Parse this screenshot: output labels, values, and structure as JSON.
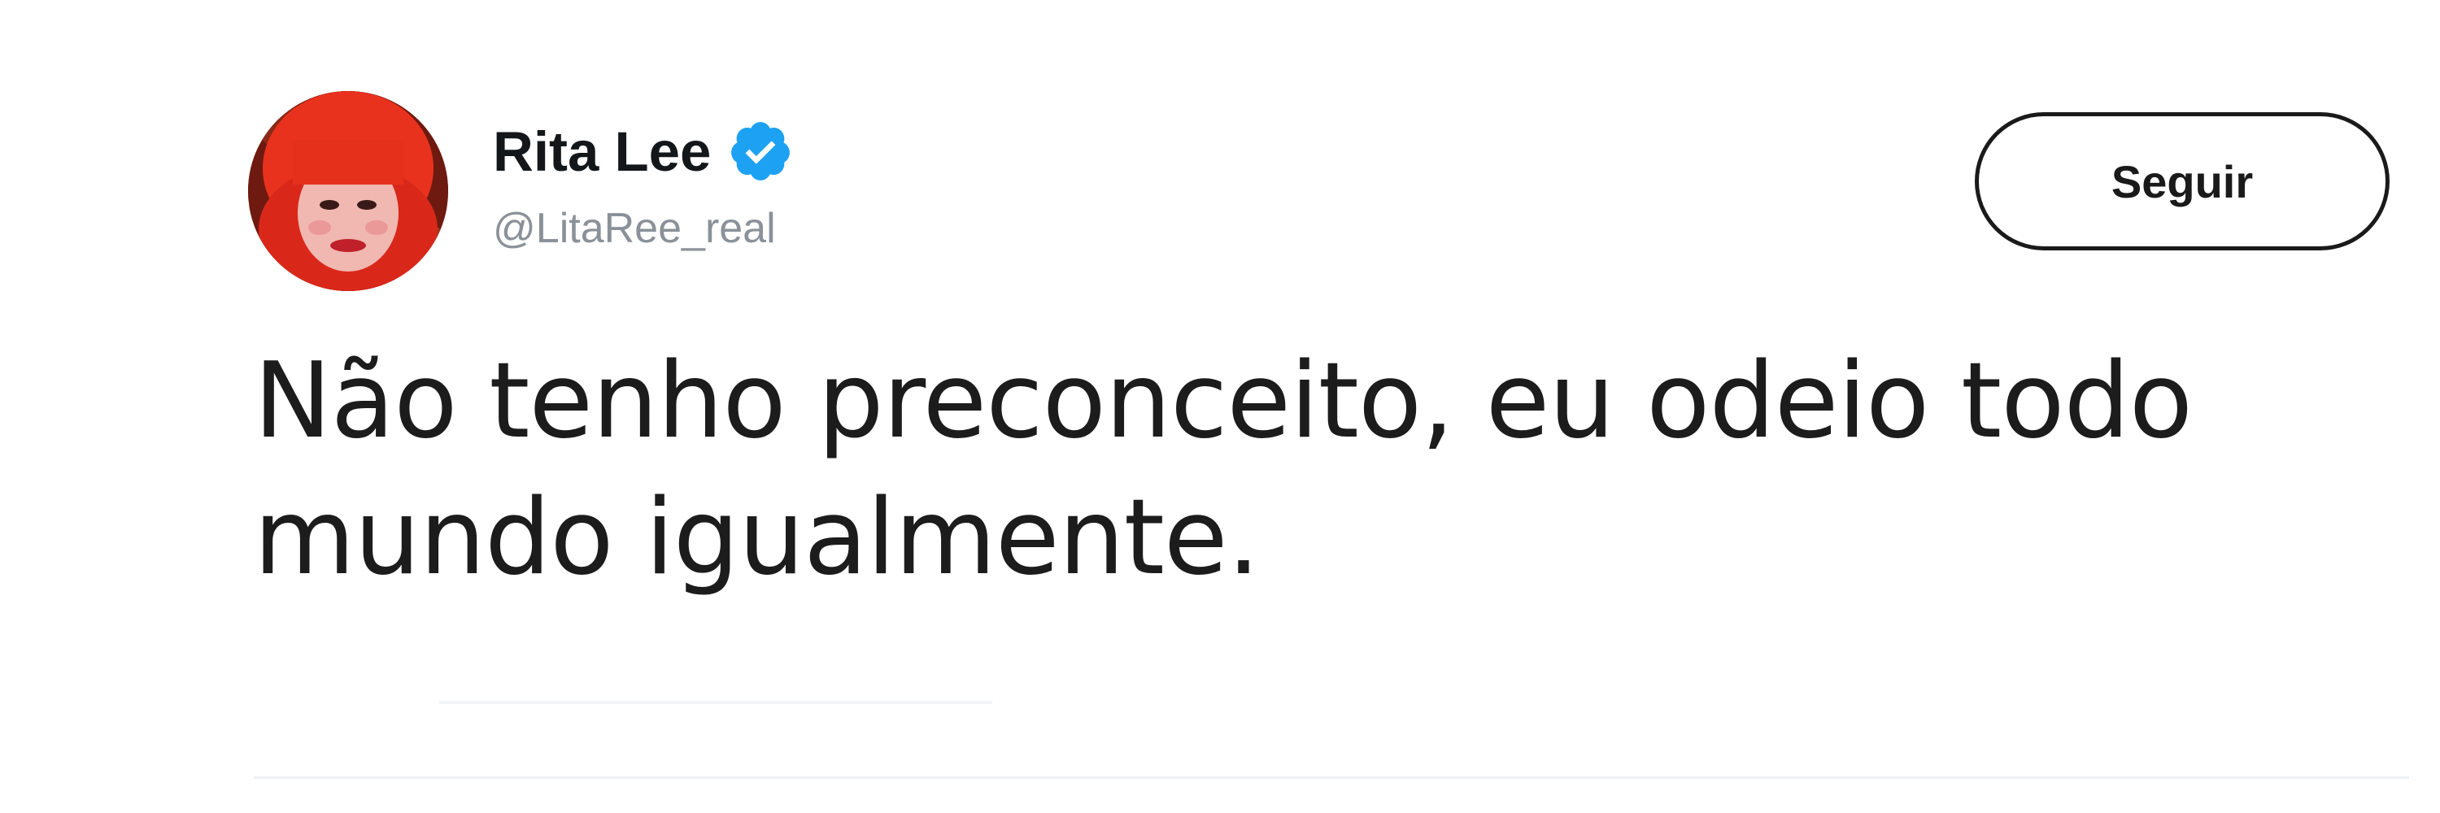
{
  "tweet": {
    "author": {
      "display_name": "Rita Lee",
      "handle": "@LitaRee_real",
      "verified_icon": "verified-badge-icon",
      "avatar": "profile-photo"
    },
    "follow_button_label": "Seguir",
    "text": "Não tenho preconceito, eu odeio todo mundo igualmente."
  },
  "colors": {
    "verified_blue": "#1da1f2",
    "name_text": "#14171a",
    "handle_text": "#8a9199",
    "body_text": "#1c1c1c",
    "button_border": "#1a1a1a"
  }
}
